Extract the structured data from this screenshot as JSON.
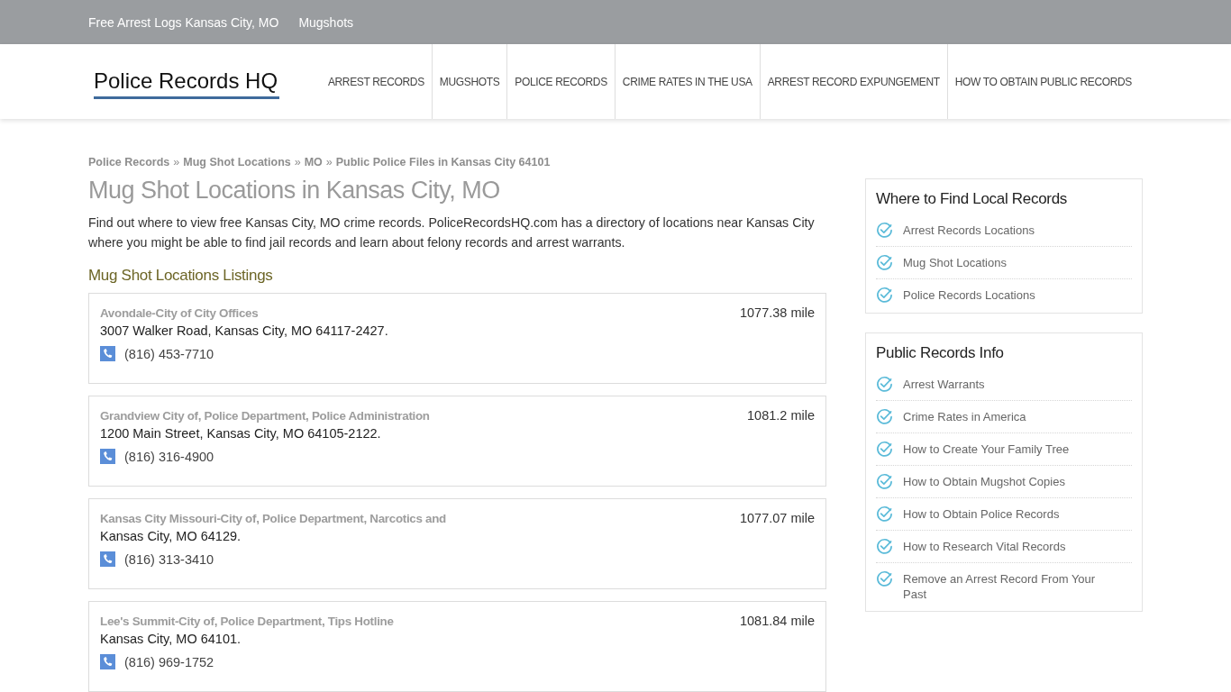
{
  "top_bar": {
    "links": [
      "Free Arrest Logs Kansas City, MO",
      "Mugshots"
    ]
  },
  "header": {
    "logo": "Police Records HQ",
    "nav": [
      "ARREST RECORDS",
      "MUGSHOTS",
      "POLICE RECORDS",
      "CRIME RATES IN THE USA",
      "ARREST RECORD EXPUNGEMENT",
      "HOW TO OBTAIN PUBLIC RECORDS"
    ]
  },
  "breadcrumb": [
    {
      "kind": "link",
      "text": "Police Records"
    },
    {
      "kind": "separator",
      "text": "»"
    },
    {
      "kind": "link",
      "text": "Mug Shot Locations"
    },
    {
      "kind": "separator",
      "text": "»"
    },
    {
      "kind": "link",
      "text": "MO"
    },
    {
      "kind": "separator",
      "text": "»"
    },
    {
      "kind": "link",
      "text": "Public Police Files in Kansas City 64101"
    }
  ],
  "title": "Mug Shot Locations in Kansas City, MO",
  "intro": "Find out where to view free Kansas City, MO crime records. PoliceRecordsHQ.com has a directory of locations near Kansas City where you might be able to find jail records and learn about felony records and arrest warrants.",
  "listings": {
    "heading": "Mug Shot Locations Listings",
    "items": [
      {
        "name": "Avondale-City of City Offices",
        "distance": "1077.38 mile",
        "address": "3007 Walker Road, Kansas City, MO 64117-2427.",
        "phone": "(816) 453-7710"
      },
      {
        "name": "Grandview City of, Police Department, Police Administration",
        "distance": "1081.2 mile",
        "address": "1200 Main Street, Kansas City, MO 64105-2122.",
        "phone": "(816) 316-4900"
      },
      {
        "name": "Kansas City Missouri-City of, Police Department, Narcotics and",
        "distance": "1077.07 mile",
        "address": "Kansas City, MO 64129.",
        "phone": "(816) 313-3410"
      },
      {
        "name": "Lee's Summit-City of, Police Department, Tips Hotline",
        "distance": "1081.84 mile",
        "address": "Kansas City, MO 64101.",
        "phone": "(816) 969-1752"
      }
    ]
  },
  "sidebar": [
    {
      "title": "Where to Find Local Records",
      "links": [
        "Arrest Records Locations",
        "Mug Shot Locations",
        "Police Records Locations"
      ]
    },
    {
      "title": "Public Records Info",
      "links": [
        "Arrest Warrants",
        "Crime Rates in America",
        "How to Create Your Family Tree",
        "How to Obtain Mugshot Copies",
        "How to Obtain Police Records",
        "How to Research Vital Records",
        "Remove an Arrest Record From Your Past"
      ]
    }
  ]
}
